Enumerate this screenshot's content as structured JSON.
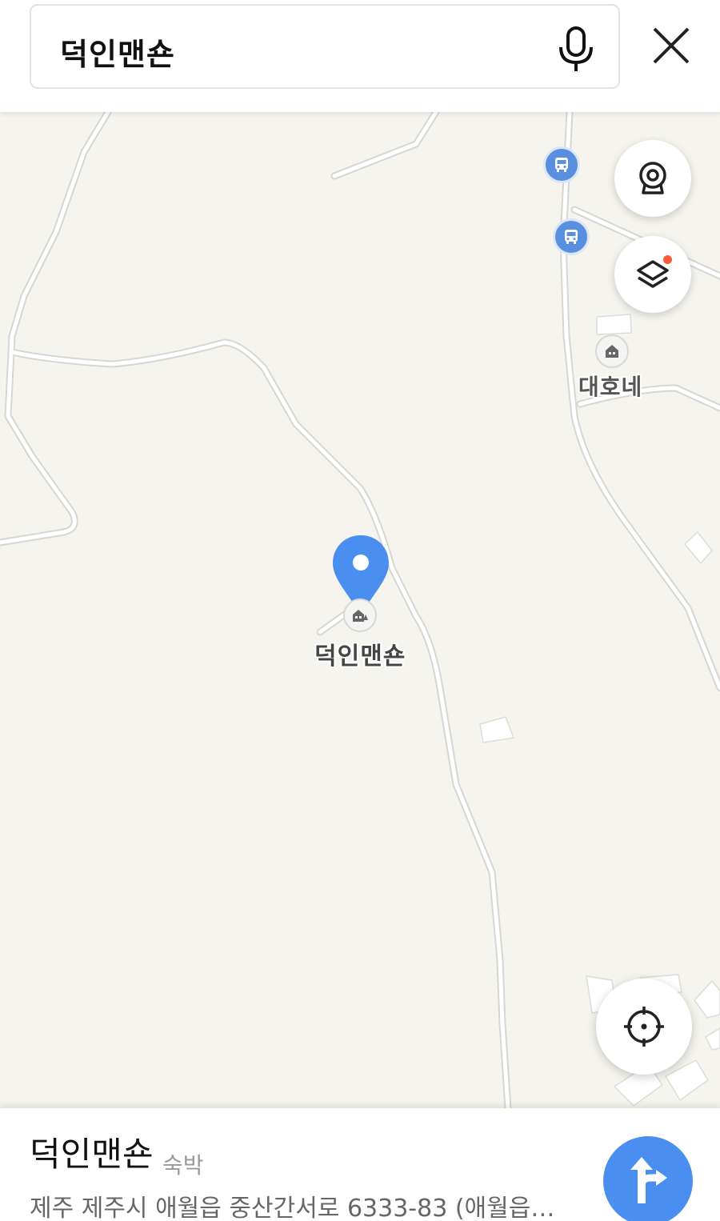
{
  "search": {
    "query": "덕인맨숀"
  },
  "map": {
    "place_marker_label": "덕인맨숀",
    "nearby_poi_label": "대호네"
  },
  "place": {
    "name": "덕인맨숀",
    "category": "숙박",
    "address": "제주 제주시 애월읍 중산간서로 6333-83 (애월읍…"
  },
  "icons": {
    "mic": "microphone-icon",
    "close": "close-icon",
    "bus": "bus-icon",
    "street_view": "street-view-icon",
    "layers": "layers-icon",
    "locate": "locate-icon",
    "route": "route-icon",
    "lodging": "lodging-icon"
  },
  "colors": {
    "accent": "#4a8ef0",
    "bus": "#5a8fe0",
    "pin": "#4a8ef0",
    "badge": "#ff5a3c"
  }
}
